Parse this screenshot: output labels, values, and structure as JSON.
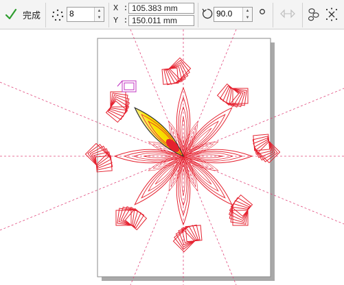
{
  "toolbar": {
    "done_label": "完成",
    "count_icon": "radial-copies-icon",
    "count_value": "8",
    "x_label": "X :",
    "x_value": "105.383 mm",
    "y_label": "Y :",
    "y_value": "150.011 mm",
    "rotate_icon": "rotate-icon",
    "angle_value": "90.0",
    "degree_icon": "degree-icon",
    "mirror_icon": "mirror-icon",
    "link_icon": "link-objects-icon",
    "reset_icon": "reset-center-icon"
  },
  "colors": {
    "accent_check": "#2e9d2e",
    "guide_line": "#e0457a",
    "flower_stroke": "#e5202e",
    "selected_square": "#c030c0",
    "petal_fill_start": "#f7e300",
    "petal_fill_end": "#ffffff"
  }
}
